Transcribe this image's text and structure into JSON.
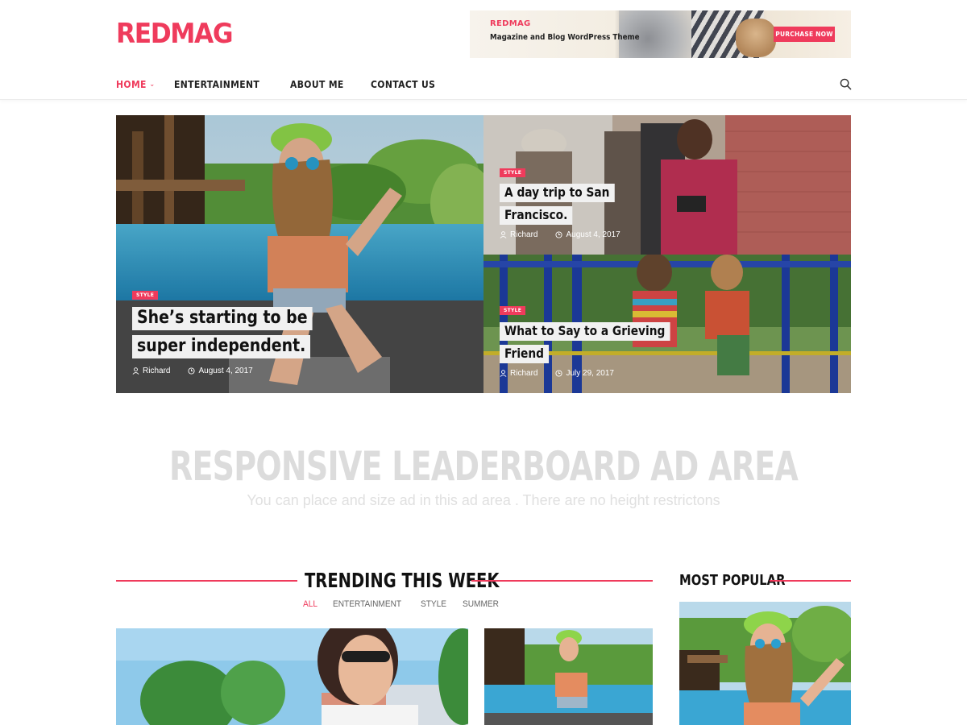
{
  "site": {
    "logo": "REDMAG"
  },
  "banner": {
    "brand": "REDMAG",
    "tagline": "Magazine and Blog WordPress Theme",
    "button": "PURCHASE NOW"
  },
  "nav": {
    "items": [
      {
        "label": "HOME",
        "active": true,
        "has_dropdown": true
      },
      {
        "label": "ENTERTAINMENT"
      },
      {
        "label": "ABOUT ME"
      },
      {
        "label": "CONTACT US"
      }
    ],
    "search_icon": "search-icon"
  },
  "hero": {
    "main": {
      "category": "STYLE",
      "title": "She’s starting to be super independent.",
      "author": "Richard",
      "date": "August 4, 2017"
    },
    "top": {
      "category": "STYLE",
      "title": "A day trip to San Francisco.",
      "author": "Richard",
      "date": "August 4, 2017"
    },
    "bottom": {
      "category": "STYLE",
      "title": "What to Say to a Grieving Friend",
      "author": "Richard",
      "date": "July 29, 2017"
    }
  },
  "ad": {
    "title": "RESPONSIVE LEADERBOARD AD  AREA",
    "subtitle": "You can place and size ad in this ad area . There are no height restrictons"
  },
  "trending": {
    "title": "TRENDING THIS WEEK",
    "filters": [
      {
        "label": "ALL",
        "active": true
      },
      {
        "label": "ENTERTAINMENT"
      },
      {
        "label": "STYLE"
      },
      {
        "label": "SUMMER"
      }
    ]
  },
  "popular": {
    "title": "MOST POPULAR"
  },
  "colors": {
    "accent": "#ef3b5c",
    "text": "#222222",
    "ad_text": "#dcdcdc"
  }
}
